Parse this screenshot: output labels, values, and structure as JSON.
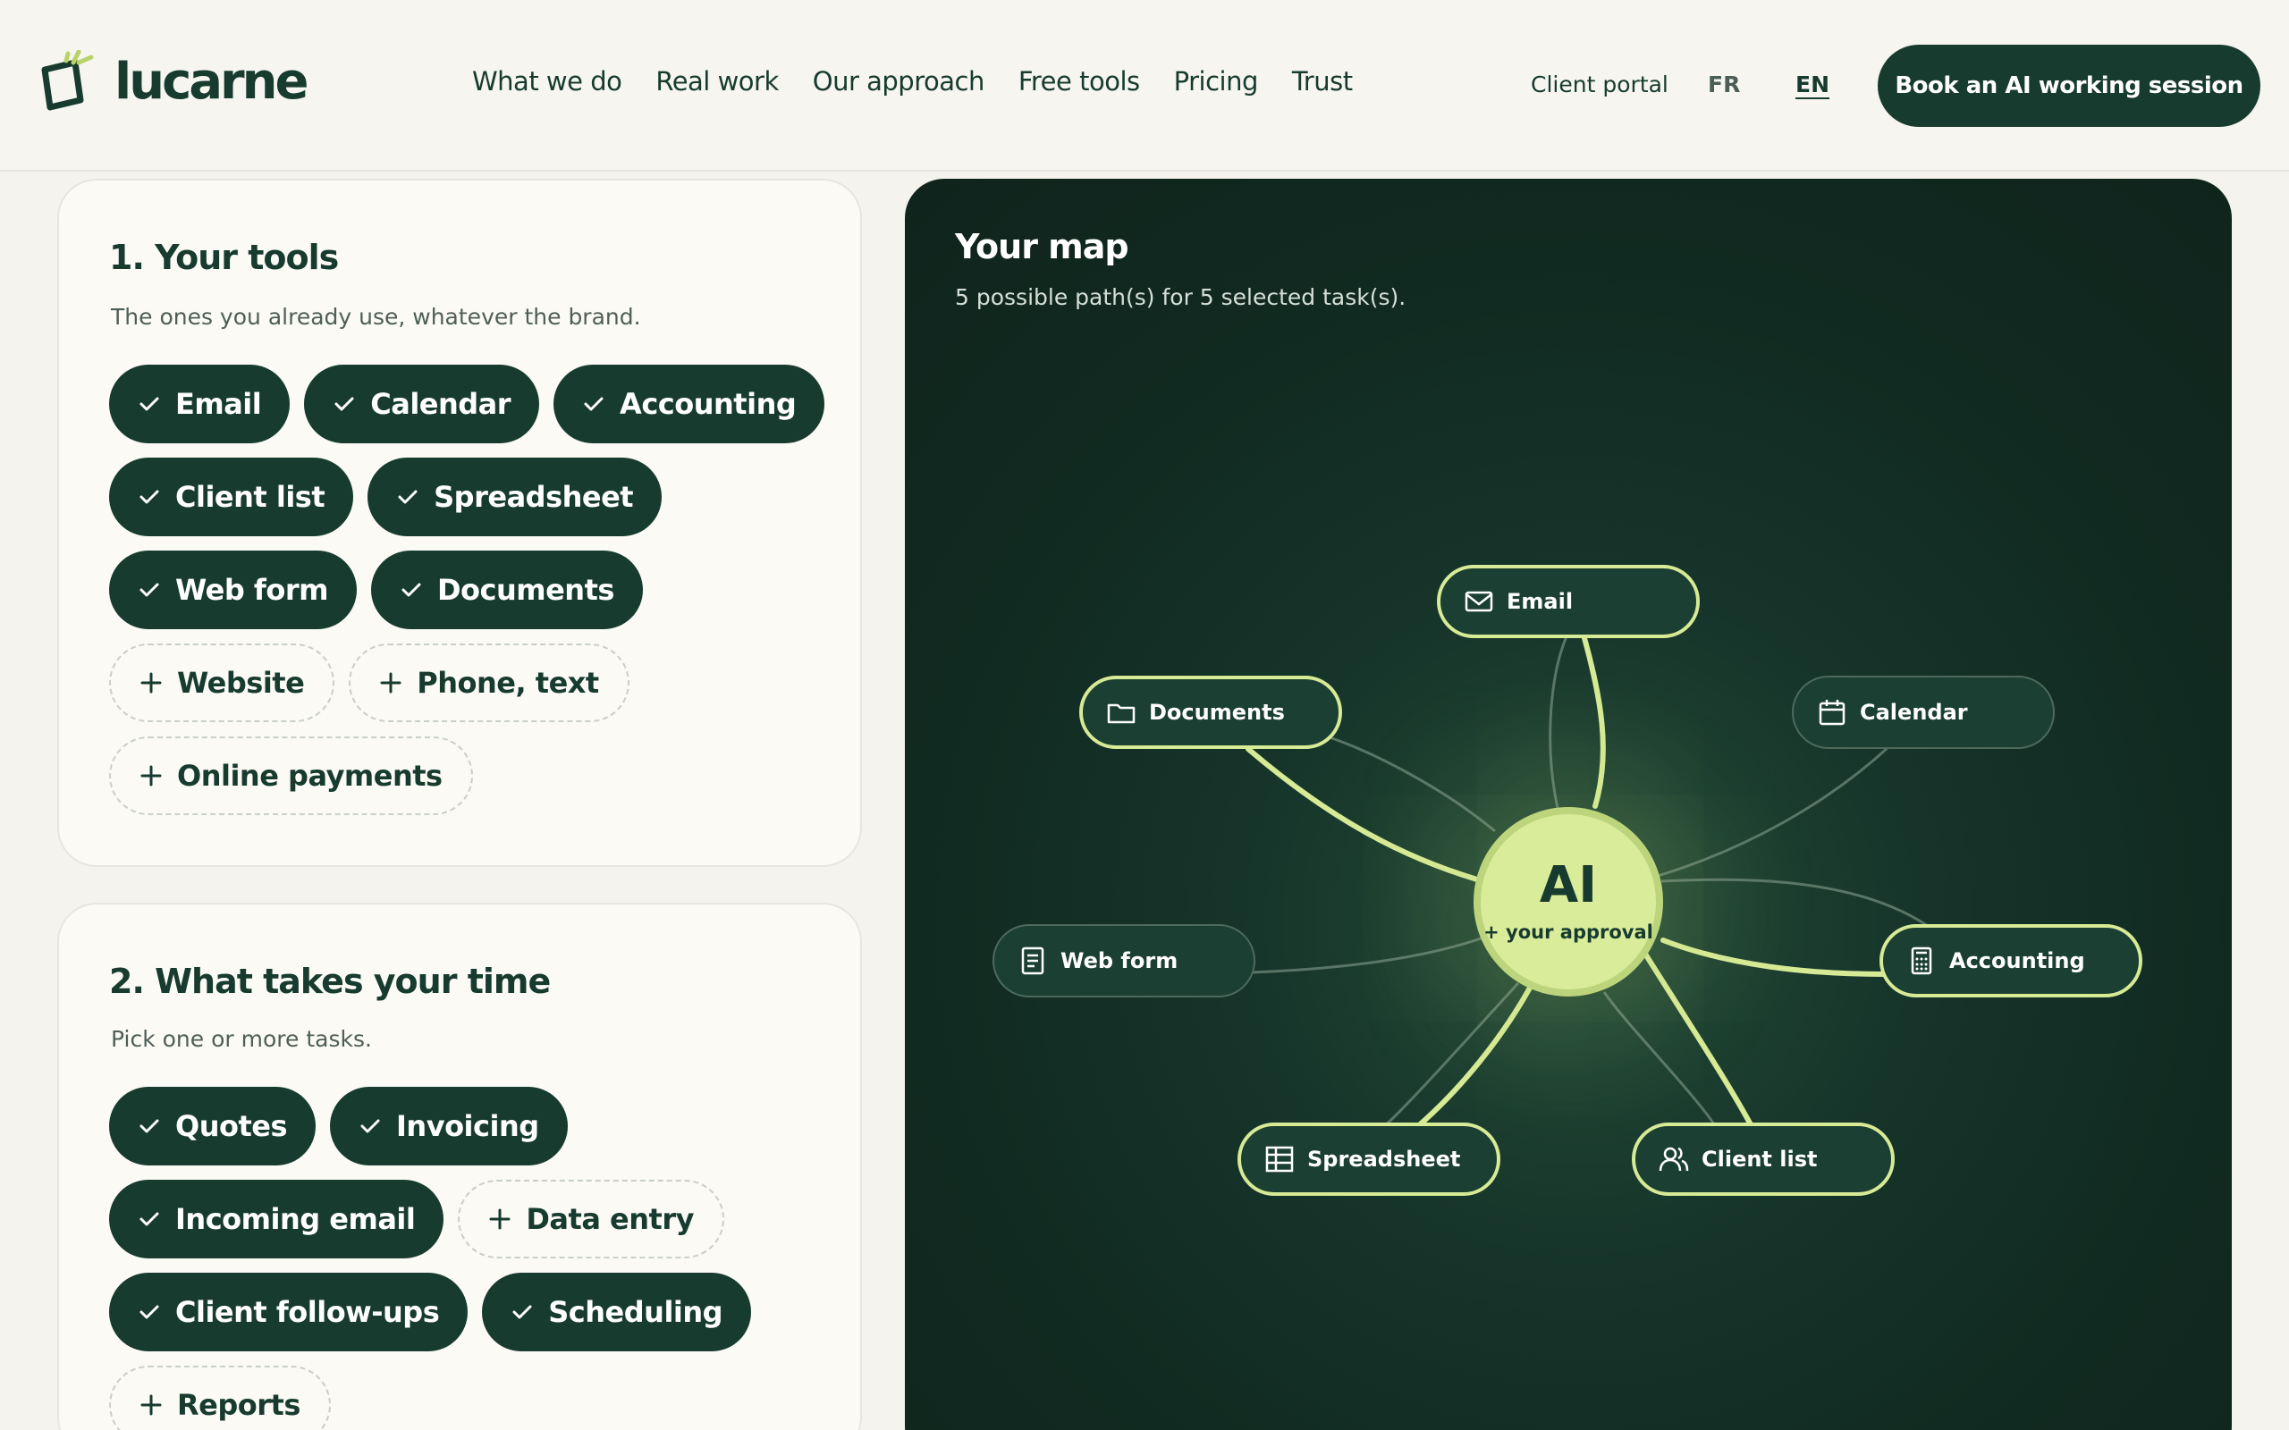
{
  "header": {
    "logo_text": "lucarne",
    "nav": [
      "What we do",
      "Real work",
      "Our approach",
      "Free tools",
      "Pricing",
      "Trust"
    ],
    "client_portal": "Client portal",
    "lang_fr": "FR",
    "lang_en": "EN",
    "cta": "Book an AI working session"
  },
  "tools_card": {
    "title": "1. Your tools",
    "subtitle": "The ones you already use, whatever the brand.",
    "chips": [
      {
        "label": "Email",
        "selected": true
      },
      {
        "label": "Calendar",
        "selected": true
      },
      {
        "label": "Accounting",
        "selected": true
      },
      {
        "label": "Client list",
        "selected": true
      },
      {
        "label": "Spreadsheet",
        "selected": true
      },
      {
        "label": "Web form",
        "selected": true
      },
      {
        "label": "Documents",
        "selected": true
      },
      {
        "label": "Website",
        "selected": false
      },
      {
        "label": "Phone, text",
        "selected": false
      },
      {
        "label": "Online payments",
        "selected": false
      }
    ]
  },
  "tasks_card": {
    "title": "2. What takes your time",
    "subtitle": "Pick one or more tasks.",
    "chips": [
      {
        "label": "Quotes",
        "selected": true
      },
      {
        "label": "Invoicing",
        "selected": true
      },
      {
        "label": "Incoming email",
        "selected": true
      },
      {
        "label": "Data entry",
        "selected": false
      },
      {
        "label": "Client follow-ups",
        "selected": true
      },
      {
        "label": "Scheduling",
        "selected": true
      },
      {
        "label": "Reports",
        "selected": false
      }
    ]
  },
  "map": {
    "title": "Your map",
    "subtitle": "5 possible path(s) for 5 selected task(s).",
    "hub_title": "AI",
    "hub_subtitle": "+ your approval",
    "nodes": [
      {
        "label": "Email",
        "icon": "mail-icon",
        "active": true
      },
      {
        "label": "Documents",
        "icon": "folder-icon",
        "active": true
      },
      {
        "label": "Calendar",
        "icon": "calendar-icon",
        "active": false
      },
      {
        "label": "Web form",
        "icon": "form-icon",
        "active": false
      },
      {
        "label": "Accounting",
        "icon": "calculator-icon",
        "active": true
      },
      {
        "label": "Spreadsheet",
        "icon": "table-icon",
        "active": true
      },
      {
        "label": "Client list",
        "icon": "users-icon",
        "active": true
      }
    ]
  },
  "colors": {
    "brand_dark": "#173b2f",
    "accent_lime": "#d7ea95",
    "background": "#f4f3ee"
  }
}
